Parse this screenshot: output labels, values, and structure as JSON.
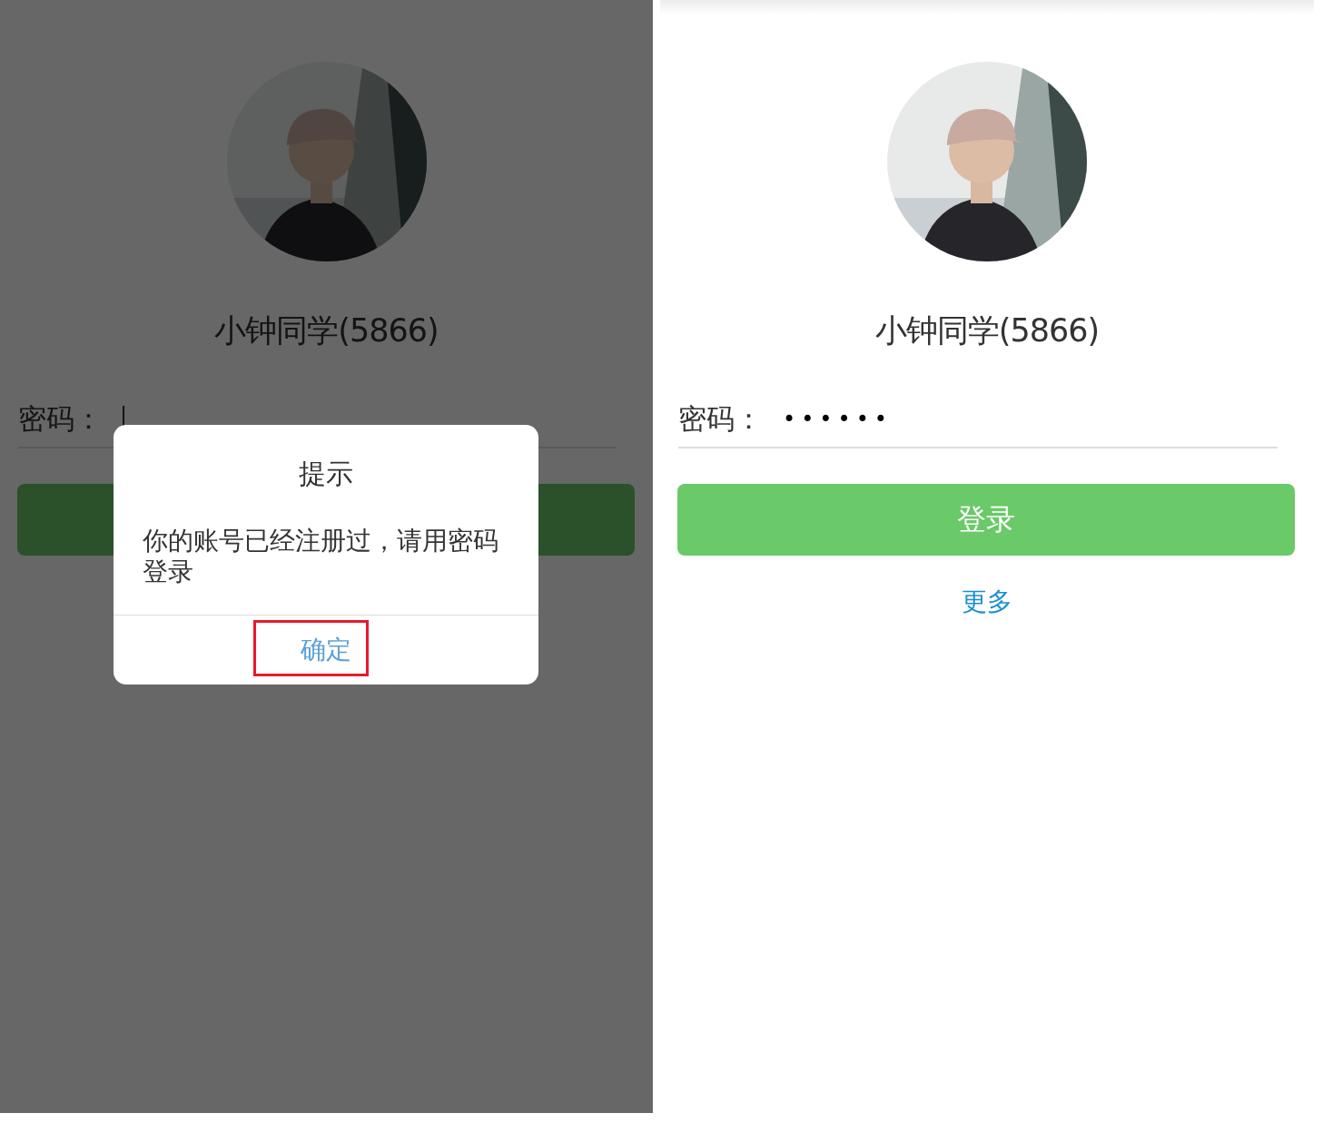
{
  "screens": [
    {
      "dimmed": true,
      "username": "小钟同学(5866)",
      "password_label": "密码：",
      "password_field": {
        "focused": true
      },
      "dialog": {
        "title": "提示",
        "message": "你的账号已经注册过，请用密码登录",
        "button": "确定",
        "highlighted": true
      }
    },
    {
      "dimmed": false,
      "username": "小钟同学(5866)",
      "password_label": "密码：",
      "password_field": {
        "value": "••••••",
        "focused": false
      },
      "login_button": "登录",
      "more_link": "更多"
    }
  ]
}
